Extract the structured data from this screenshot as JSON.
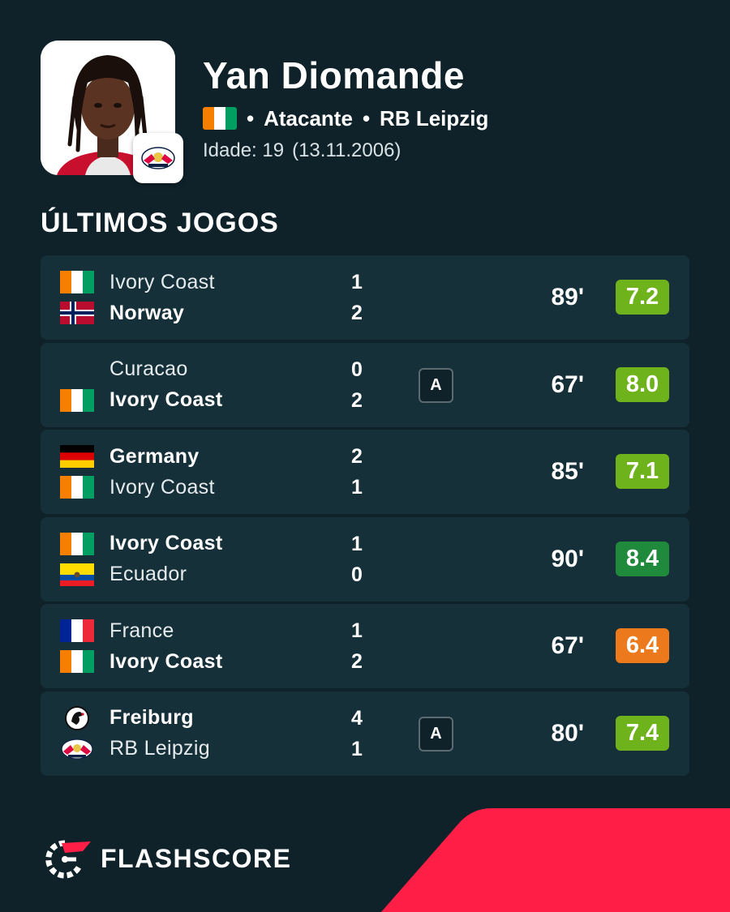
{
  "player": {
    "name": "Yan Diomande",
    "position": "Atacante",
    "club": "RB Leipzig",
    "age_label": "Idade: 19",
    "birthdate": "(13.11.2006)",
    "flag_icon": "ivory-coast-flag"
  },
  "section_title": "ÚLTIMOS JOGOS",
  "colors": {
    "background": "#0f2229",
    "card": "#16303a",
    "rating_light_green": "#6fb31c",
    "rating_dark_green": "#1f8a3b",
    "rating_orange": "#ec7a1c",
    "brand_red": "#ff1e46"
  },
  "matches": [
    {
      "home": {
        "name": "Ivory Coast",
        "icon": "ivory-coast-flag",
        "bold": false
      },
      "away": {
        "name": "Norway",
        "icon": "norway-flag",
        "bold": true
      },
      "home_score": "1",
      "away_score": "2",
      "badge": "",
      "minutes": "89'",
      "rating": "7.2",
      "rating_color": "#6fb31c"
    },
    {
      "home": {
        "name": "Curacao",
        "icon": "",
        "bold": false
      },
      "away": {
        "name": "Ivory Coast",
        "icon": "ivory-coast-flag",
        "bold": true
      },
      "home_score": "0",
      "away_score": "2",
      "badge": "A",
      "minutes": "67'",
      "rating": "8.0",
      "rating_color": "#6fb31c"
    },
    {
      "home": {
        "name": "Germany",
        "icon": "germany-flag",
        "bold": true
      },
      "away": {
        "name": "Ivory Coast",
        "icon": "ivory-coast-flag",
        "bold": false
      },
      "home_score": "2",
      "away_score": "1",
      "badge": "",
      "minutes": "85'",
      "rating": "7.1",
      "rating_color": "#6fb31c"
    },
    {
      "home": {
        "name": "Ivory Coast",
        "icon": "ivory-coast-flag",
        "bold": true
      },
      "away": {
        "name": "Ecuador",
        "icon": "ecuador-flag",
        "bold": false
      },
      "home_score": "1",
      "away_score": "0",
      "badge": "",
      "minutes": "90'",
      "rating": "8.4",
      "rating_color": "#1f8a3b"
    },
    {
      "home": {
        "name": "France",
        "icon": "france-flag",
        "bold": false
      },
      "away": {
        "name": "Ivory Coast",
        "icon": "ivory-coast-flag",
        "bold": true
      },
      "home_score": "1",
      "away_score": "2",
      "badge": "",
      "minutes": "67'",
      "rating": "6.4",
      "rating_color": "#ec7a1c"
    },
    {
      "home": {
        "name": "Freiburg",
        "icon": "freiburg-crest",
        "bold": true
      },
      "away": {
        "name": "RB Leipzig",
        "icon": "rb-leipzig-crest",
        "bold": false
      },
      "home_score": "4",
      "away_score": "1",
      "badge": "A",
      "minutes": "80'",
      "rating": "7.4",
      "rating_color": "#6fb31c"
    }
  ],
  "brand": {
    "name": "FLASHSCORE",
    "icon": "flashscore-logo-icon"
  }
}
